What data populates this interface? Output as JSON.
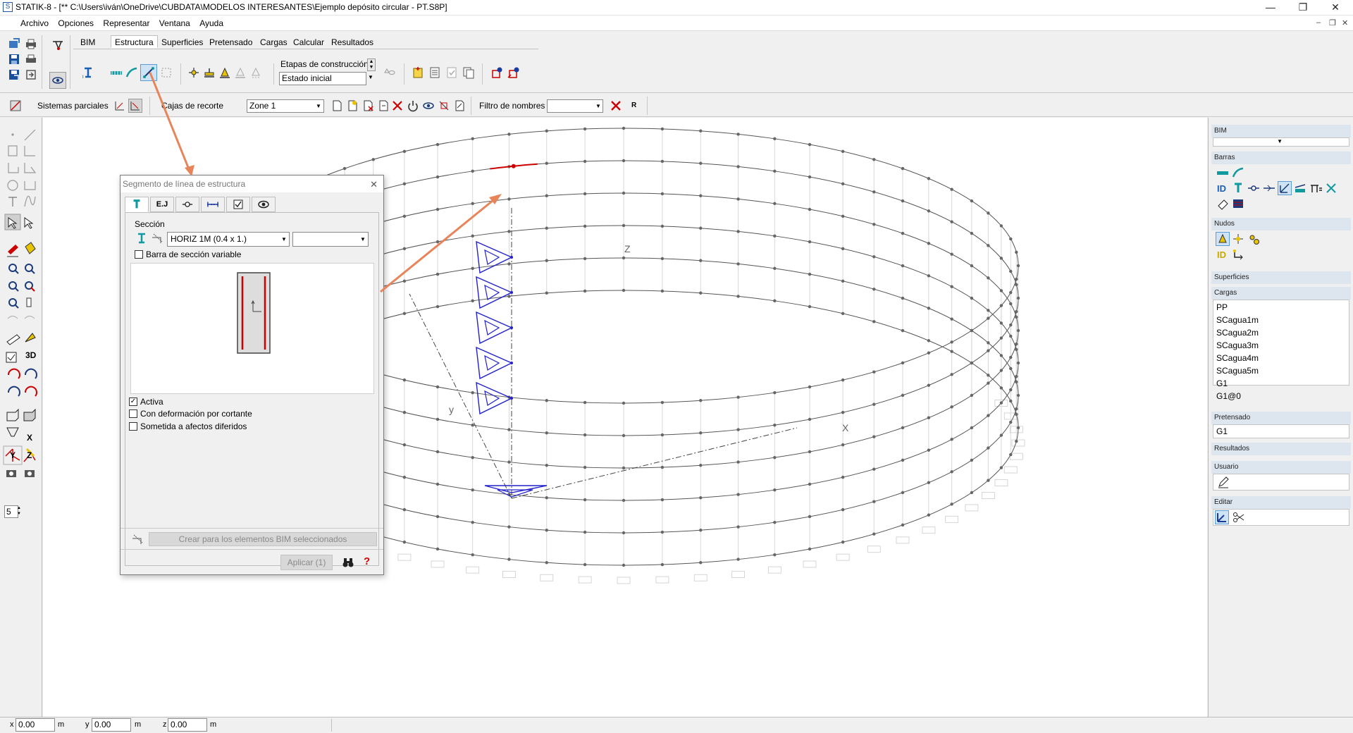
{
  "window": {
    "title": "STATIK-8 - [** C:\\Users\\iván\\OneDrive\\CUBDATA\\MODELOS INTERESANTES\\Ejemplo depósito circular - PT.S8P]",
    "minimize": "—",
    "maximize": "❐",
    "close": "✕"
  },
  "menu": {
    "items": [
      "Archivo",
      "Opciones",
      "Representar",
      "Ventana",
      "Ayuda"
    ],
    "doc_min": "–",
    "doc_restore": "❐",
    "doc_close": "✕"
  },
  "ribbon": {
    "tabs": [
      "BIM",
      "Estructura",
      "Superficies",
      "Pretensado",
      "Cargas",
      "Calcular",
      "Resultados"
    ],
    "active_tab": "Estructura",
    "stages_label": "Etapas de construcción",
    "stages_value": "Estado inicial"
  },
  "toolbar2": {
    "partial_systems_label": "Sistemas parciales",
    "clip_boxes_label": "Cajas de recorte",
    "zone_value": "Zone 1",
    "name_filter_label": "Filtro de nombres",
    "name_filter_value": "",
    "r_label": "R"
  },
  "left": {
    "spin_value": "5",
    "btn_3d": "3D",
    "axis_x": "X",
    "axis_y": "Y",
    "axis_z": "Z"
  },
  "canvas": {
    "axis_x": "X",
    "axis_y": "y",
    "axis_z": "Z"
  },
  "right_panel": {
    "bim_label": "BIM",
    "bars_label": "Barras",
    "nodes_label": "Nudos",
    "surfaces_label": "Superficies",
    "loads_label": "Cargas",
    "loads": [
      "PP",
      "SCagua1m",
      "SCagua2m",
      "SCagua3m",
      "SCagua4m",
      "SCagua5m",
      "G1",
      "G1@0"
    ],
    "prestress_label": "Pretensado",
    "prestress_value": "G1",
    "results_label": "Resultados",
    "user_label": "Usuario",
    "edit_label": "Editar",
    "id_label": "ID"
  },
  "dialog": {
    "title": "Segmento de línea de estructura",
    "close": "✕",
    "section_label": "Sección",
    "section_value": "HORIZ 1M (0.4 x 1.)",
    "section_value2": "",
    "variable_section_label": "Barra de sección variable",
    "active_label": "Activa",
    "shear_label": "Con deformación por cortante",
    "deferred_label": "Sometida a afectos diferidos",
    "bim_create_button": "Crear para los elementos BIM seleccionados",
    "apply_button": "Aplicar (1)",
    "help": "?",
    "ej_tab": "E.J",
    "checks": {
      "variable_section": false,
      "active": true,
      "shear": false,
      "deferred": false
    }
  },
  "status": {
    "x_label": "x",
    "x_value": "0.00",
    "x_unit": "m",
    "y_label": "y",
    "y_value": "0.00",
    "y_unit": "m",
    "z_label": "z",
    "z_value": "0.00",
    "z_unit": "m"
  },
  "colors": {
    "accent_blue": "#1a5fb4",
    "load_blue": "#2222cc",
    "selected_red": "#cc0000",
    "arrow_orange": "#e8845a",
    "teal": "#0f9aa0"
  }
}
